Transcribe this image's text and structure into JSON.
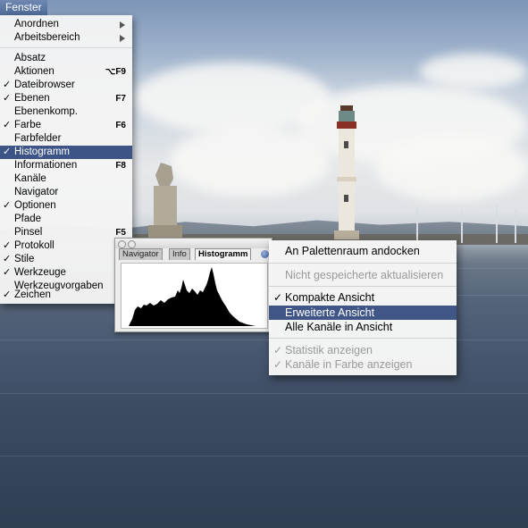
{
  "menubar": {
    "title": "Fenster"
  },
  "fenster_menu": {
    "items": [
      {
        "label": "Anordnen",
        "checked": false,
        "shortcut": "",
        "submenu": true
      },
      {
        "label": "Arbeitsbereich",
        "checked": false,
        "shortcut": "",
        "submenu": true
      },
      {
        "label": "Absatz",
        "checked": false,
        "shortcut": ""
      },
      {
        "label": "Aktionen",
        "checked": false,
        "shortcut": "⌥F9"
      },
      {
        "label": "Dateibrowser",
        "checked": true,
        "shortcut": ""
      },
      {
        "label": "Ebenen",
        "checked": true,
        "shortcut": "F7"
      },
      {
        "label": "Ebenenkomp.",
        "checked": false,
        "shortcut": ""
      },
      {
        "label": "Farbe",
        "checked": true,
        "shortcut": "F6"
      },
      {
        "label": "Farbfelder",
        "checked": false,
        "shortcut": ""
      },
      {
        "label": "Histogramm",
        "checked": true,
        "shortcut": "",
        "selected": true
      },
      {
        "label": "Informationen",
        "checked": false,
        "shortcut": "F8"
      },
      {
        "label": "Kanäle",
        "checked": false,
        "shortcut": ""
      },
      {
        "label": "Navigator",
        "checked": false,
        "shortcut": ""
      },
      {
        "label": "Optionen",
        "checked": true,
        "shortcut": ""
      },
      {
        "label": "Pfade",
        "checked": false,
        "shortcut": ""
      },
      {
        "label": "Pinsel",
        "checked": false,
        "shortcut": "F5"
      },
      {
        "label": "Protokoll",
        "checked": true,
        "shortcut": ""
      },
      {
        "label": "Stile",
        "checked": true,
        "shortcut": ""
      },
      {
        "label": "Werkzeuge",
        "checked": true,
        "shortcut": ""
      },
      {
        "label": "Werkzeugvorgaben",
        "checked": false,
        "shortcut": ""
      },
      {
        "label": "Zeichen",
        "checked": true,
        "shortcut": ""
      }
    ],
    "check_glyph": "✓"
  },
  "histogram_palette": {
    "tabs": [
      "Navigator",
      "Info",
      "Histogramm"
    ],
    "active_tab": "Histogramm"
  },
  "palette_menu": {
    "items": [
      {
        "label": "An Palettenraum andocken",
        "checked": false,
        "disabled": false
      },
      {
        "label": "Nicht gespeicherte aktualisieren",
        "checked": false,
        "disabled": true
      },
      {
        "label": "Kompakte Ansicht",
        "checked": true,
        "disabled": false
      },
      {
        "label": "Erweiterte Ansicht",
        "checked": false,
        "disabled": false,
        "selected": true
      },
      {
        "label": "Alle Kanäle in Ansicht",
        "checked": false,
        "disabled": false
      },
      {
        "label": "Statistik anzeigen",
        "checked": true,
        "disabled": true
      },
      {
        "label": "Kanäle in Farbe anzeigen",
        "checked": true,
        "disabled": true
      }
    ]
  },
  "colors": {
    "selection": "#3d5586",
    "menu_bg": "#f4f4f4",
    "disabled_text": "#9a9a9a"
  }
}
